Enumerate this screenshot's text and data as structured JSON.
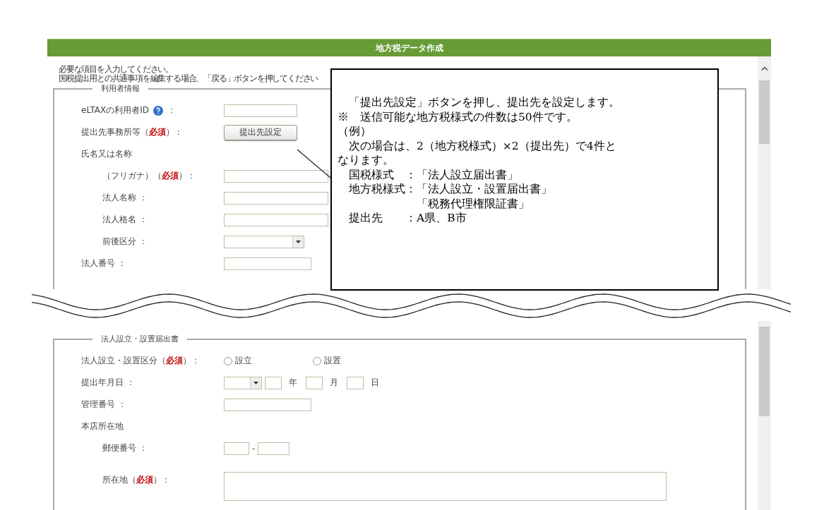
{
  "window": {
    "title": "地方税データ作成"
  },
  "instructions": [
    "必要な項目を入力してください。",
    "国税提出用との共通事項を編集する場合、「戻る」ボタンを押してください"
  ],
  "sections": [
    {
      "legend": "利用者情報",
      "rows": [
        {
          "kind": "short-text",
          "label": "eLTAXの利用者ID",
          "help": true,
          "after_help": "："
        },
        {
          "kind": "button",
          "label": "提出先事務所等（**必須**）：",
          "button": "提出先設定"
        },
        {
          "kind": "heading",
          "label": "氏名又は名称",
          "children": [
            {
              "kind": "long-text",
              "label": "（フリガナ）（**必須**）："
            },
            {
              "kind": "long-text",
              "label": "法人名称 ："
            },
            {
              "kind": "long-text",
              "label": "法人格名 ："
            },
            {
              "kind": "select",
              "label": "前後区分 ："
            }
          ]
        },
        {
          "kind": "text",
          "label": "法人番号 ："
        }
      ]
    },
    {
      "legend": "法人設立・設置届出書",
      "rows": [
        {
          "kind": "radio",
          "label": "法人設立・設置区分（**必須**）：",
          "options": [
            {
              "label": "設立",
              "selected": false
            },
            {
              "label": "設置",
              "selected": false
            }
          ]
        },
        {
          "kind": "date",
          "label": "提出年月日 ：",
          "units": [
            "年",
            "月",
            "日"
          ]
        },
        {
          "kind": "text",
          "label": "管理番号 ："
        },
        {
          "kind": "heading",
          "label": "本店所在地",
          "children": [
            {
              "kind": "postal",
              "label": "郵便番号 ：",
              "separator": "-"
            },
            {
              "kind": "textarea",
              "label": "所在地（**必須**）："
            }
          ]
        }
      ]
    }
  ],
  "callout": {
    "lines": [
      "　「提出先設定」ボタンを押し、提出先を設定します。",
      "※　送信可能な地方税様式の件数は50件です。",
      "（例）",
      "　次の場合は、2（地方税様式）×2（提出先）で4件と",
      "なります。",
      "　国税様式　：「法人設立届出書」",
      "　地方税様式：「法人設立・設置届出書」",
      "　　　　　　　「税務代理権限証書」",
      "　提出先　　：A県、B市"
    ]
  }
}
